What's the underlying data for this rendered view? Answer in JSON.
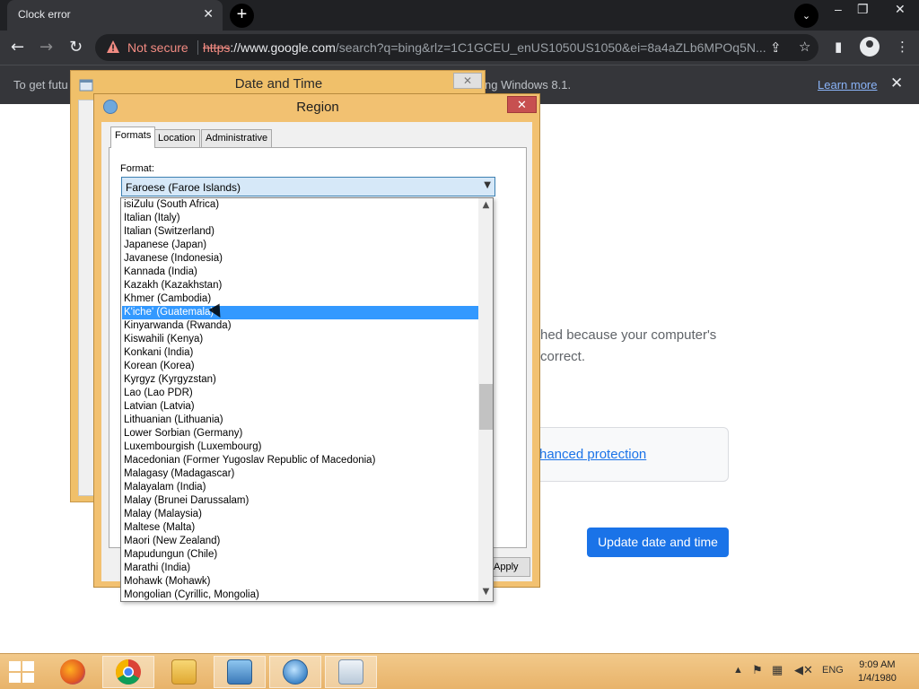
{
  "browser": {
    "tab_title": "Clock error",
    "tab_close": "✕",
    "new_tab": "+",
    "tab_search": "⌄",
    "window_controls": {
      "minimize": "–",
      "restore": "❐",
      "close": "✕"
    },
    "nav": {
      "back": "←",
      "forward": "→",
      "reload": "↻"
    },
    "security_label": "Not secure",
    "url_scheme": "https",
    "url_host": "://www.google.com",
    "url_path": "/search?q=bing&rlz=1C1GCEU_enUS1050US1050&ei=8a4aZLb6MPOq5N...",
    "toolbar_icons": {
      "share": "⇪",
      "bookmark": "☆",
      "sidepanel": "▮",
      "menu": "⋮"
    },
    "infobar": {
      "text_left": "To get futu",
      "text_right": "ng Windows 8.1.",
      "learn_more": "Learn more",
      "close": "✕"
    }
  },
  "page": {
    "text_line1": "hed because your computer's",
    "text_line2": "correct.",
    "protection_link": "hanced protection",
    "update_button": "Update date and time"
  },
  "date_time_dialog": {
    "title": "Date and Time",
    "close": "✕"
  },
  "region_dialog": {
    "title": "Region",
    "close": "✕",
    "tabs": [
      "Formats",
      "Location",
      "Administrative"
    ],
    "format_label": "Format:",
    "format_selected": "Faroese (Faroe Islands)",
    "apply_label": "Apply",
    "dropdown_items": [
      "isiZulu (South Africa)",
      "Italian (Italy)",
      "Italian (Switzerland)",
      "Japanese (Japan)",
      "Javanese (Indonesia)",
      "Kannada (India)",
      "Kazakh (Kazakhstan)",
      "Khmer (Cambodia)",
      "K'iche' (Guatemala)",
      "Kinyarwanda (Rwanda)",
      "Kiswahili (Kenya)",
      "Konkani (India)",
      "Korean (Korea)",
      "Kyrgyz (Kyrgyzstan)",
      "Lao (Lao PDR)",
      "Latvian (Latvia)",
      "Lithuanian (Lithuania)",
      "Lower Sorbian (Germany)",
      "Luxembourgish (Luxembourg)",
      "Macedonian (Former Yugoslav Republic of Macedonia)",
      "Malagasy (Madagascar)",
      "Malayalam (India)",
      "Malay (Brunei Darussalam)",
      "Malay (Malaysia)",
      "Maltese (Malta)",
      "Maori (New Zealand)",
      "Mapudungun (Chile)",
      "Marathi (India)",
      "Mohawk (Mohawk)",
      "Mongolian (Cyrillic, Mongolia)"
    ],
    "highlighted_item": "K'iche' (Guatemala)"
  },
  "taskbar": {
    "apps": [
      "firefox-icon",
      "chrome-icon",
      "file-explorer-icon",
      "control-panel-icon",
      "date-time-icon",
      "region-icon"
    ],
    "language": "ENG",
    "time": "9:09 AM",
    "date": "1/4/1980"
  },
  "colors": {
    "chrome_dark": "#202124",
    "chrome_toolbar": "#35363a",
    "not_secure": "#f28b82",
    "link_blue": "#1a73e8",
    "dialog_frame": "#f2c171",
    "selection": "#3399ff"
  }
}
